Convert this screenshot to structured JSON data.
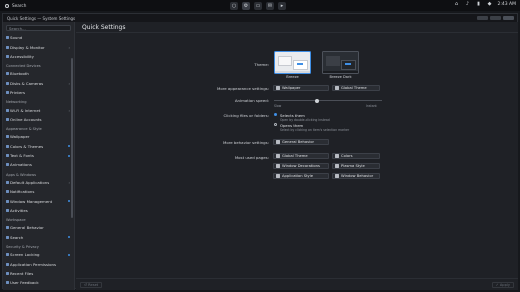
{
  "top_panel": {
    "search_label": "Search",
    "clock": "2:43 AM",
    "app_icons": [
      "circle-app-icon",
      "settings-app-icon",
      "files-app-icon",
      "mail-app-icon",
      "terminal-app-icon"
    ],
    "tray_icons": [
      "network-icon",
      "volume-icon",
      "battery-icon",
      "notifications-icon"
    ]
  },
  "window": {
    "title": "Quick Settings — System Settings"
  },
  "sidebar": {
    "search_placeholder": "Search...",
    "items": [
      {
        "type": "item",
        "label": "Sound",
        "icon": "sound-icon"
      },
      {
        "type": "item",
        "label": "Display & Monitor",
        "icon": "display-icon",
        "arrow": "›"
      },
      {
        "type": "item",
        "label": "Accessibility",
        "icon": "accessibility-icon"
      },
      {
        "type": "group",
        "label": "Connected Devices"
      },
      {
        "type": "item",
        "label": "Bluetooth",
        "icon": "bluetooth-icon"
      },
      {
        "type": "item",
        "label": "Disks & Cameras",
        "icon": "disk-icon",
        "arrow": "›"
      },
      {
        "type": "item",
        "label": "Printers",
        "icon": "printer-icon"
      },
      {
        "type": "group",
        "label": "Networking"
      },
      {
        "type": "item",
        "label": "Wi-Fi & Internet",
        "icon": "wifi-icon",
        "arrow": "›"
      },
      {
        "type": "item",
        "label": "Online Accounts",
        "icon": "accounts-icon"
      },
      {
        "type": "group",
        "label": "Appearance & Style"
      },
      {
        "type": "item",
        "label": "Wallpaper",
        "icon": "wallpaper-icon"
      },
      {
        "type": "item",
        "label": "Colors & Themes",
        "icon": "themes-icon",
        "dot": true
      },
      {
        "type": "item",
        "label": "Text & Fonts",
        "icon": "fonts-icon",
        "dot": true
      },
      {
        "type": "item",
        "label": "Animations",
        "icon": "animations-icon"
      },
      {
        "type": "group",
        "label": "Apps & Windows"
      },
      {
        "type": "item",
        "label": "Default Applications",
        "icon": "default-apps-icon",
        "arrow": "›"
      },
      {
        "type": "item",
        "label": "Notifications",
        "icon": "notifications-icon"
      },
      {
        "type": "item",
        "label": "Window Management",
        "icon": "window-management-icon",
        "dot": true
      },
      {
        "type": "item",
        "label": "Activities",
        "icon": "activities-icon"
      },
      {
        "type": "group",
        "label": "Workspace"
      },
      {
        "type": "item",
        "label": "General Behavior",
        "icon": "general-behavior-icon"
      },
      {
        "type": "item",
        "label": "Search",
        "icon": "search-icon",
        "dot": true
      },
      {
        "type": "group",
        "label": "Security & Privacy"
      },
      {
        "type": "item",
        "label": "Screen Locking",
        "icon": "lock-icon",
        "dot": true
      },
      {
        "type": "item",
        "label": "Application Permissions",
        "icon": "permissions-icon"
      },
      {
        "type": "item",
        "label": "Recent Files",
        "icon": "recent-files-icon"
      },
      {
        "type": "item",
        "label": "User Feedback",
        "icon": "feedback-icon"
      }
    ]
  },
  "main": {
    "title": "Quick Settings",
    "theme_label": "Theme:",
    "themes": [
      {
        "caption": "Breeze",
        "bg": "#e9ebee",
        "accent": "#3f8fe6",
        "panel": "#f7f7f8"
      },
      {
        "caption": "Breeze Dark",
        "bg": "#2a2e34",
        "accent": "#3f8fe6",
        "panel": "#3b3f46"
      }
    ],
    "more_appearance_label": "More appearance settings:",
    "wallpaper_button": "Wallpaper",
    "global_theme_button": "Global Theme",
    "animation_speed_label": "Animation speed:",
    "slow_label": "Slow",
    "instant_label": "Instant",
    "animation_speed_value_percent": 40,
    "click_label": "Clicking files or folders:",
    "select_them_label": "Selects them",
    "select_them_sub": "Open by double-clicking instead",
    "open_them_label": "Opens them",
    "open_them_sub": "Select by clicking on item's selection marker",
    "more_behavior_label": "More behavior settings:",
    "general_behavior_button": "General Behavior",
    "most_used_label": "Most used pages:",
    "most_used": [
      "Global Theme",
      "Colors",
      "Window Decorations",
      "Plasma Style",
      "Application Style",
      "Window Behavior"
    ],
    "reset_button": "Reset",
    "apply_button": "Apply",
    "accent_color": "#3f8fe6"
  }
}
